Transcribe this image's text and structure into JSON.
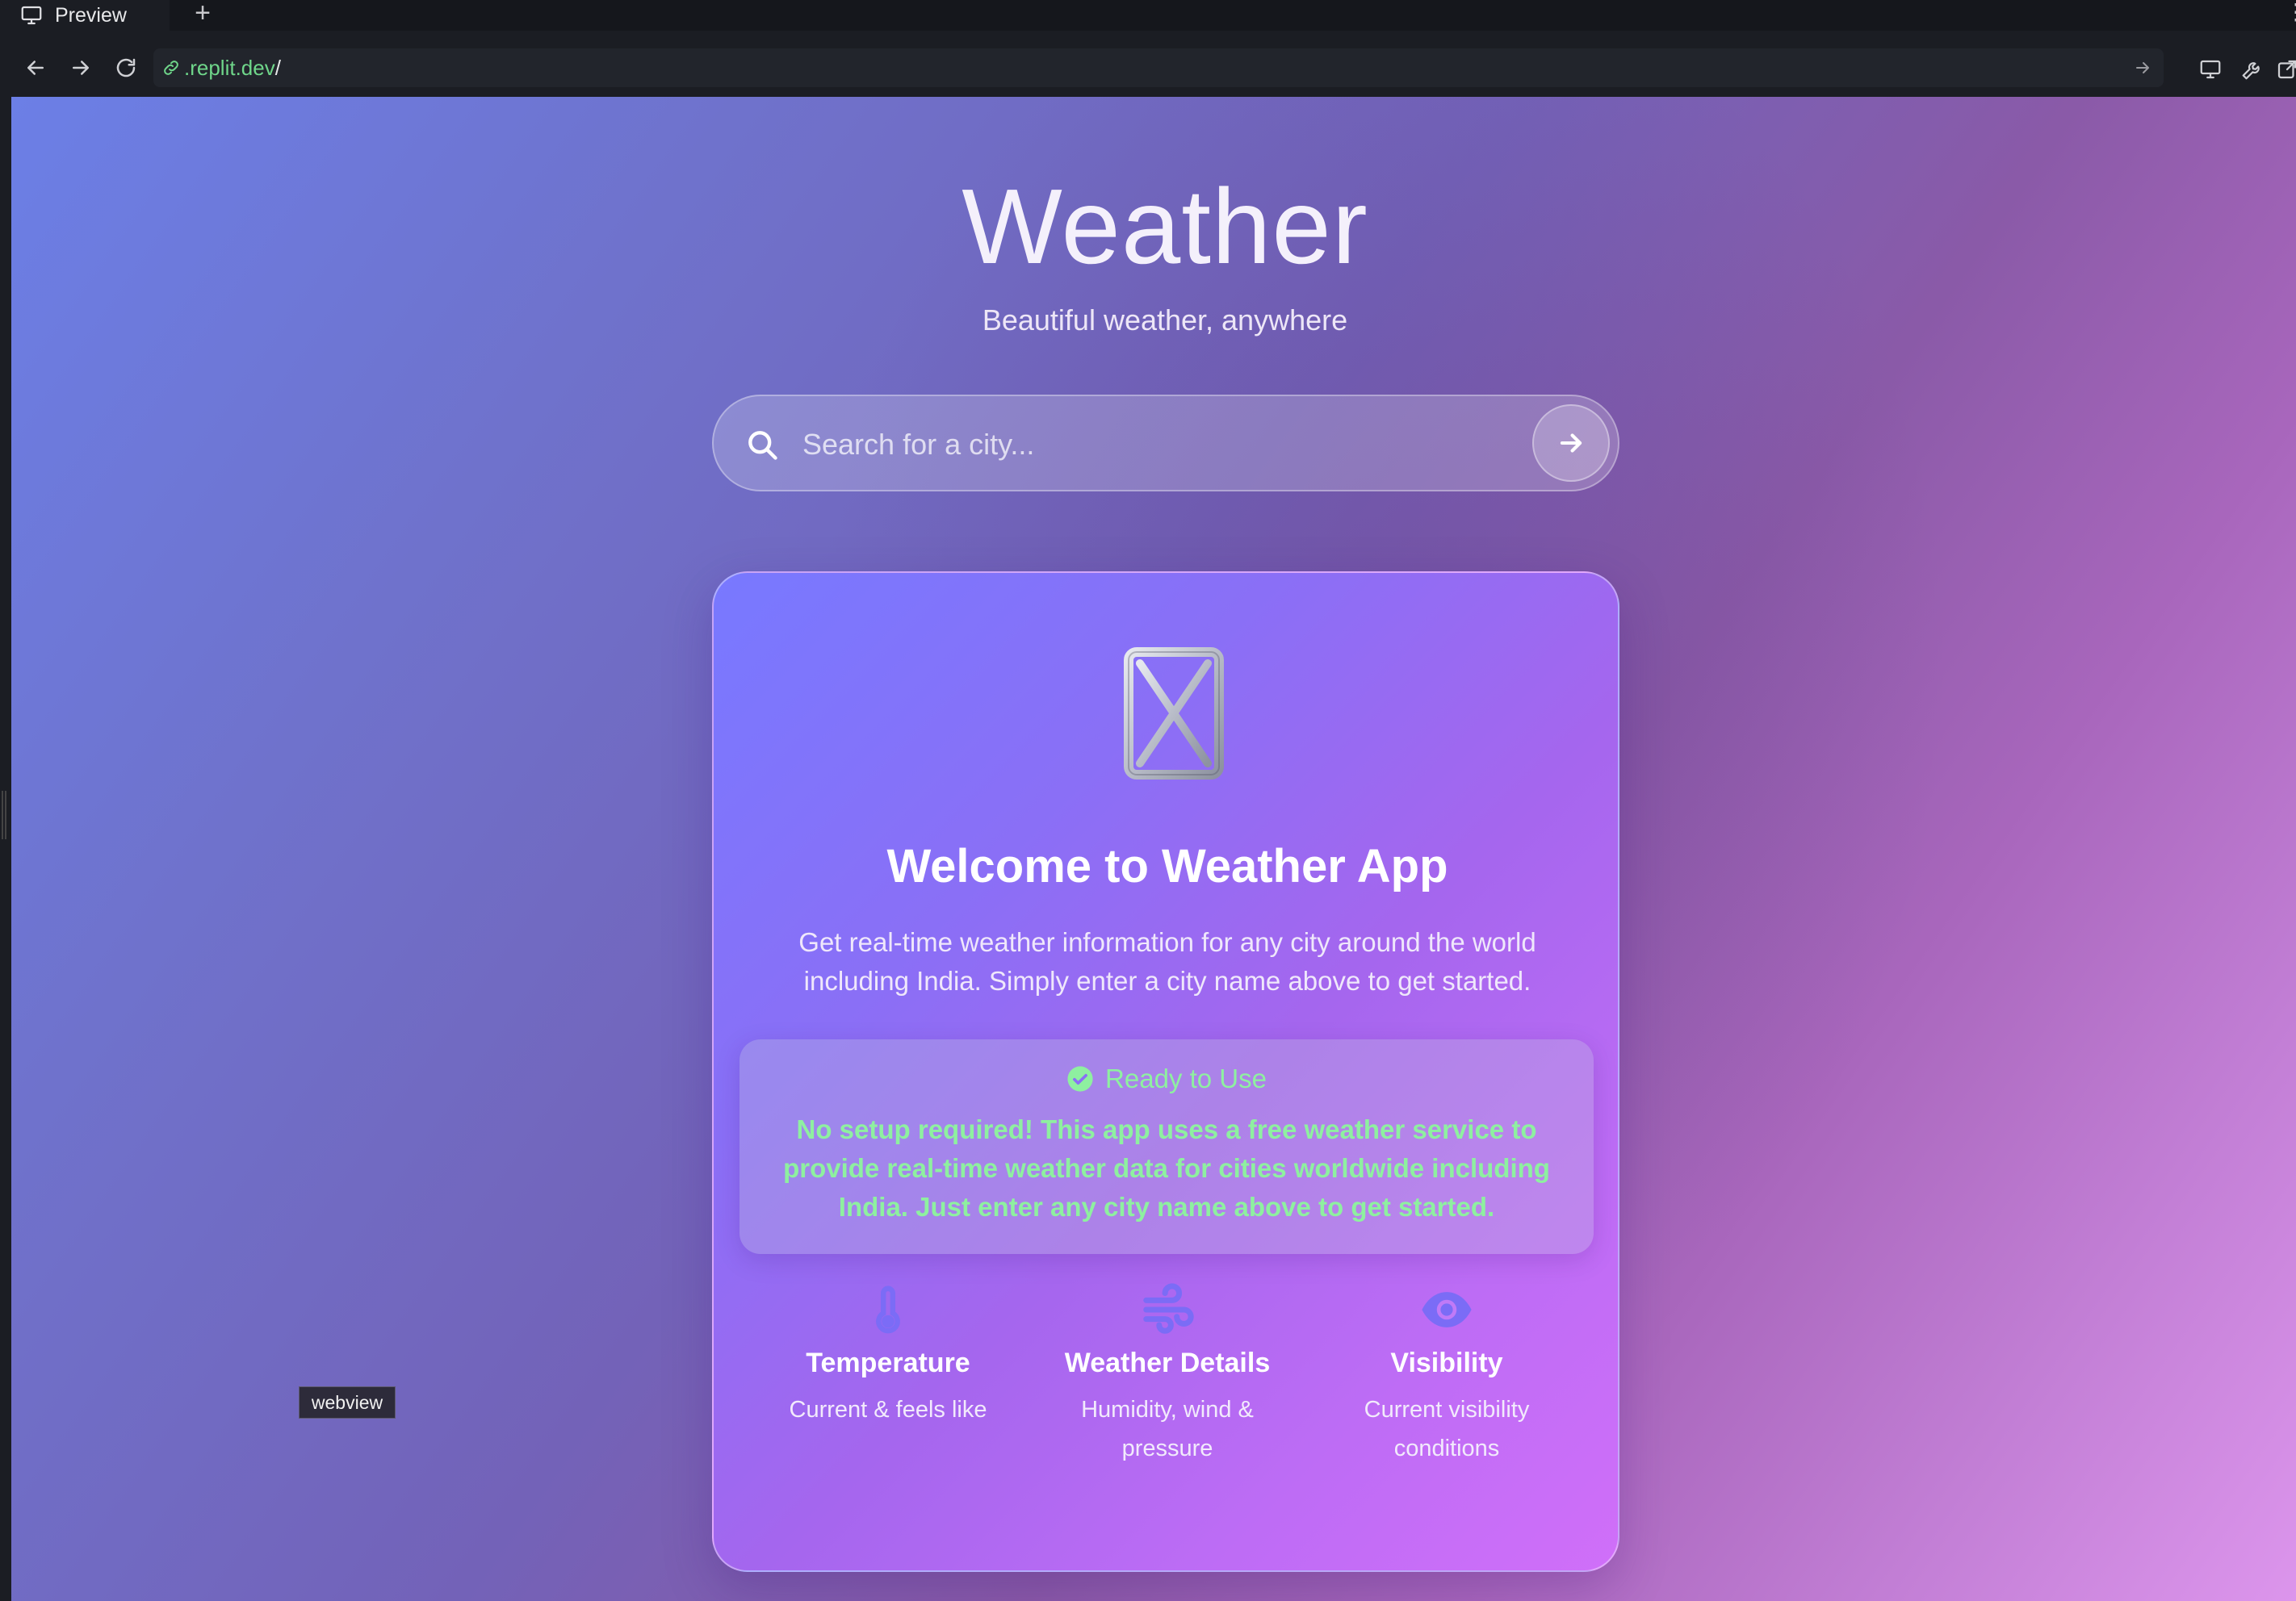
{
  "browser": {
    "tab_label": "Preview",
    "tab_add": "+",
    "url_host": ".replit.dev",
    "url_path": "/"
  },
  "app": {
    "title": "Weather",
    "subtitle": "Beautiful weather, anywhere"
  },
  "search": {
    "placeholder": "Search for a city...",
    "value": ""
  },
  "welcome": {
    "title": "Welcome to Weather App",
    "description": "Get real-time weather information for any city around the world including India. Simply enter a city name above to get started."
  },
  "ready": {
    "heading": "Ready to Use",
    "text": "No setup required! This app uses a free weather service to provide real-time weather data for cities worldwide including India. Just enter any city name above to get started."
  },
  "features": [
    {
      "icon": "thermometer-icon",
      "title": "Temperature",
      "description": "Current & feels like"
    },
    {
      "icon": "wind-icon",
      "title": "Weather Details",
      "description": "Humidity, wind & pressure"
    },
    {
      "icon": "eye-icon",
      "title": "Visibility",
      "description": "Current visibility conditions"
    }
  ],
  "tooltip": "webview",
  "colors": {
    "accent_green": "#8ef0a0",
    "url_green": "#6fd68a",
    "feature_icon": "#7b6cf6"
  }
}
